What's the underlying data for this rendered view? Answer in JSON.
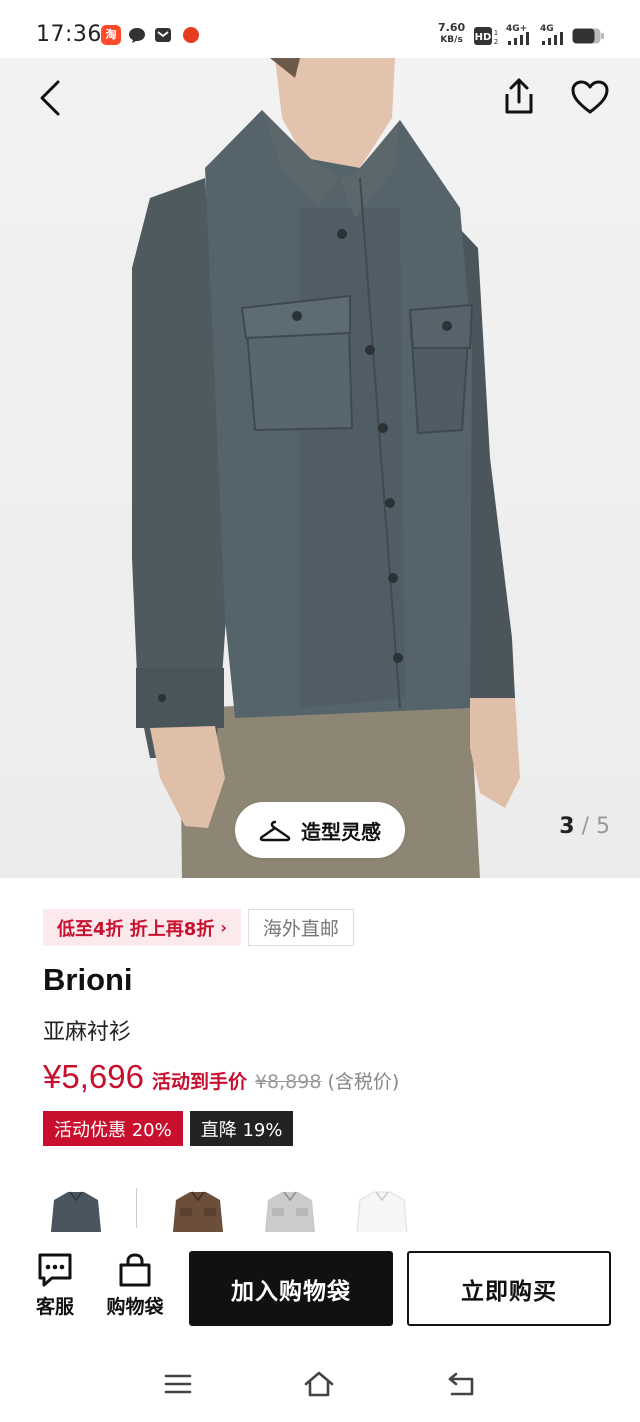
{
  "status_bar": {
    "time": "17:36",
    "taobao_glyph": "淘",
    "speed_value": "7.60",
    "speed_unit": "KB/s",
    "network_1": "4G+",
    "network_2": "4G",
    "icons": [
      "taobao-app-icon",
      "message-icon",
      "mail-icon",
      "app-dot-icon",
      "hd-voice-icon",
      "signal-icon",
      "signal-icon",
      "battery-icon"
    ]
  },
  "header": {
    "icons": [
      "back-arrow-icon",
      "share-icon",
      "heart-icon"
    ]
  },
  "gallery": {
    "styling_label": "造型灵感",
    "current_page": "3",
    "separator": "/",
    "total_pages": "5"
  },
  "product": {
    "promo_label": "低至4折 折上再8折",
    "promo_chevron": "›",
    "shipping_label": "海外直邮",
    "brand": "Brioni",
    "name": "亚麻衬衫",
    "price": "¥5,696",
    "price_note": "活动到手价",
    "original_price": "¥8,898",
    "tax_note": "(含税价)",
    "badge_discount": "活动优惠 20%",
    "badge_direct": "直降 19%"
  },
  "swatches": [
    {
      "name": "denim-blue",
      "color": "#4a5560"
    },
    {
      "name": "brown",
      "color": "#6b4f3b"
    },
    {
      "name": "light-grey",
      "color": "#c9ccc8"
    },
    {
      "name": "white",
      "color": "#f6f6f6"
    }
  ],
  "bottom_bar": {
    "service_label": "客服",
    "bag_label": "购物袋",
    "add_to_bag": "加入购物袋",
    "buy_now": "立即购买"
  },
  "colors": {
    "accent_red": "#c8102e",
    "promo_bg": "#fbe9ec",
    "dark": "#111111"
  }
}
